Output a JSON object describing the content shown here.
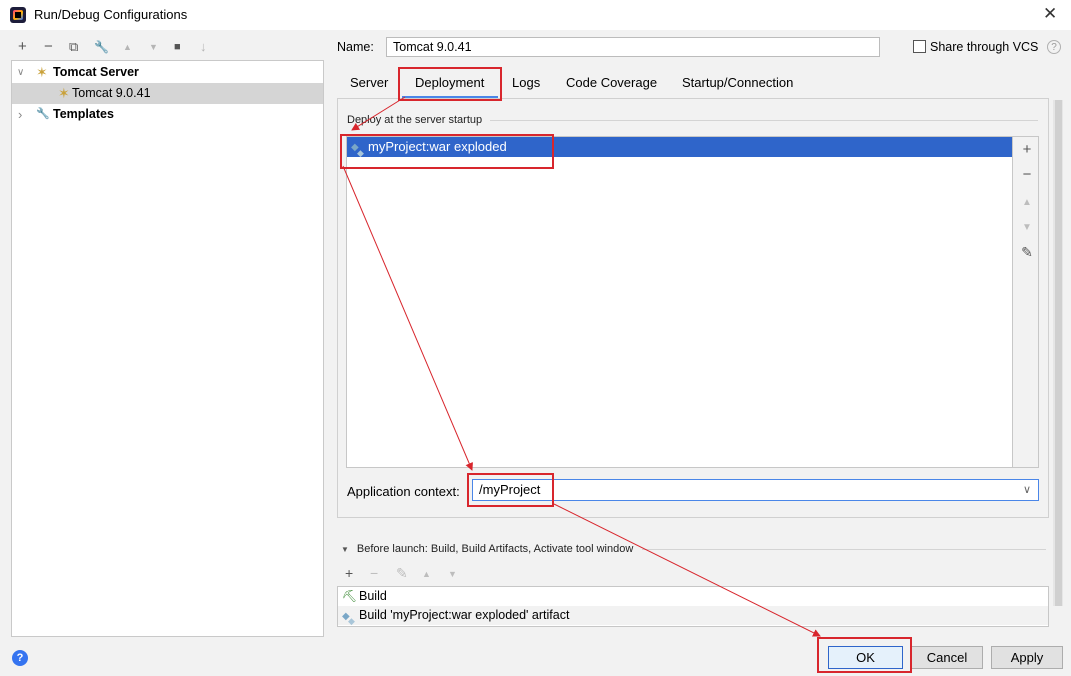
{
  "window": {
    "title": "Run/Debug Configurations",
    "close_glyph": "✕"
  },
  "left_toolbar": {
    "add_glyph": "+",
    "remove_glyph": "−",
    "copy_glyph": "⧉",
    "edit_glyph": "🔧",
    "up_glyph": "▲",
    "down_glyph": "▼",
    "folder_glyph": "■",
    "sort_glyph": "↓"
  },
  "tree": {
    "items": [
      {
        "label": "Tomcat Server",
        "icon": "tomcat-icon",
        "expanded": true
      },
      {
        "label": "Tomcat 9.0.41",
        "icon": "tomcat-icon",
        "selected": true
      },
      {
        "label": "Templates",
        "icon": "wrench-icon",
        "expanded": false
      }
    ],
    "expanded_glyph": "∨",
    "collapsed_glyph": "›",
    "wrench_glyph": "🔧"
  },
  "config": {
    "name_label": "Name:",
    "name_value": "Tomcat 9.0.41",
    "share_vcs_label": "Share through VCS",
    "share_vcs_checked": false,
    "help_glyph": "?"
  },
  "tabs": [
    {
      "label": "Server"
    },
    {
      "label": "Deployment",
      "active": true
    },
    {
      "label": "Logs"
    },
    {
      "label": "Code Coverage"
    },
    {
      "label": "Startup/Connection"
    }
  ],
  "deployment": {
    "section_label": "Deploy at the server startup",
    "artifacts": [
      {
        "label": "myProject:war exploded",
        "selected": true
      }
    ],
    "side_toolbar": {
      "add": "+",
      "remove": "−",
      "up": "▲",
      "down": "▼",
      "edit": "✎"
    },
    "app_context_label": "Application context:",
    "app_context_value": "/myProject",
    "dropdown_glyph": "∨"
  },
  "before_launch": {
    "label": "Before launch: Build, Build Artifacts, Activate tool window",
    "collapse_glyph": "▼",
    "toolbar": {
      "add": "+",
      "remove": "−",
      "edit": "✎",
      "up": "▲",
      "down": "▼"
    },
    "tasks": [
      {
        "label": "Build",
        "icon": "hammer-icon"
      },
      {
        "label": "Build 'myProject:war exploded' artifact",
        "icon": "artifact-icon"
      }
    ],
    "hammer_glyph": "⛏"
  },
  "buttons": {
    "help": "?",
    "ok": "OK",
    "cancel": "Cancel",
    "apply": "Apply"
  },
  "colors": {
    "selection": "#2f65ca",
    "annotation": "#d8262d",
    "tab_accent": "#4a86e8"
  }
}
